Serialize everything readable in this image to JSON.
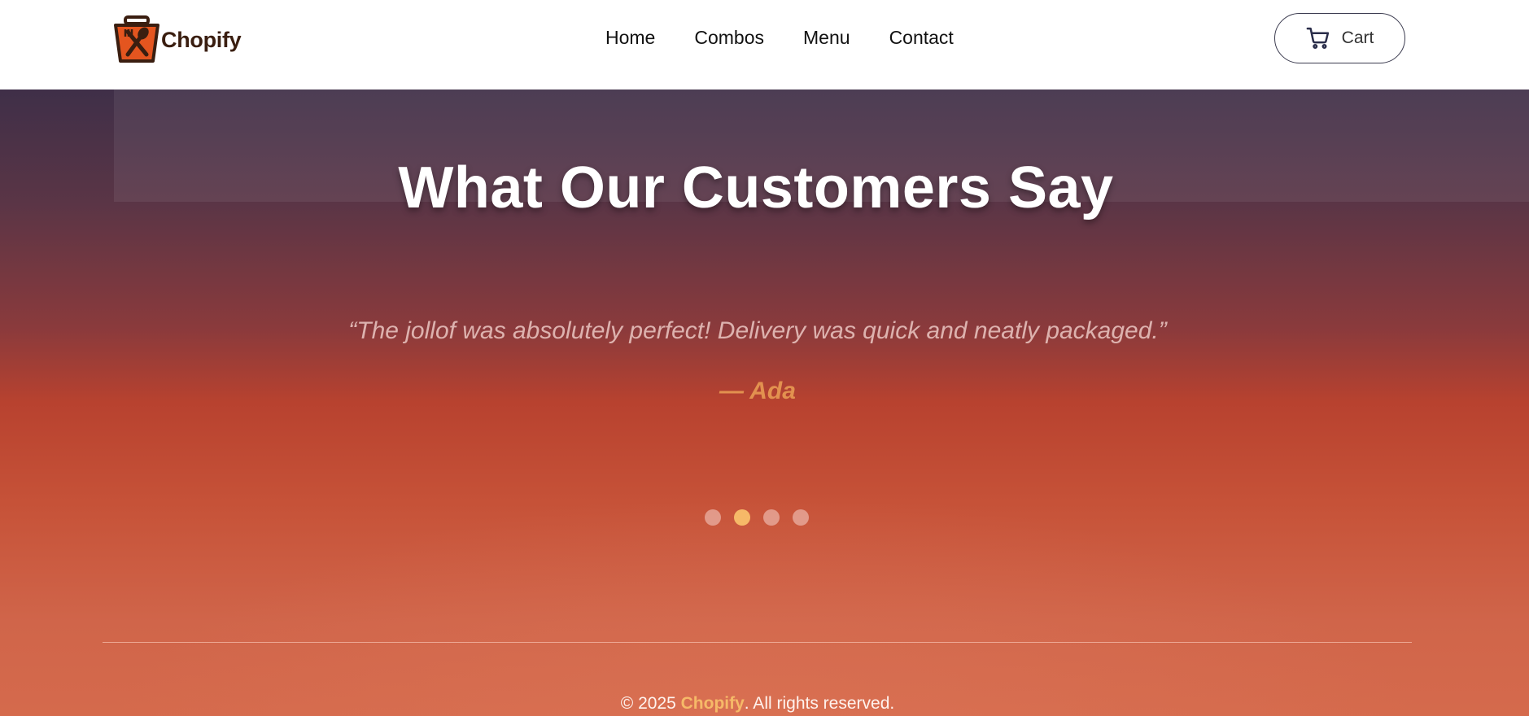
{
  "header": {
    "logo_text": "Chopify",
    "nav": [
      {
        "label": "Home"
      },
      {
        "label": "Combos"
      },
      {
        "label": "Menu"
      },
      {
        "label": "Contact"
      }
    ],
    "cart_label": "Cart"
  },
  "testimonials": {
    "title": "What Our Customers Say",
    "quote": "“The jollof was absolutely perfect! Delivery was quick and neatly packaged.”",
    "author": "— Ada",
    "dots": [
      {
        "active": false
      },
      {
        "active": true
      },
      {
        "active": false
      },
      {
        "active": false
      }
    ]
  },
  "footer": {
    "prefix": "© 2025 ",
    "brand": "Chopify",
    "suffix": ". All rights reserved."
  },
  "colors": {
    "accent": "#f6b968",
    "author": "#e2914f",
    "logo_orange": "#e4551f",
    "logo_dark": "#3a1e10"
  }
}
